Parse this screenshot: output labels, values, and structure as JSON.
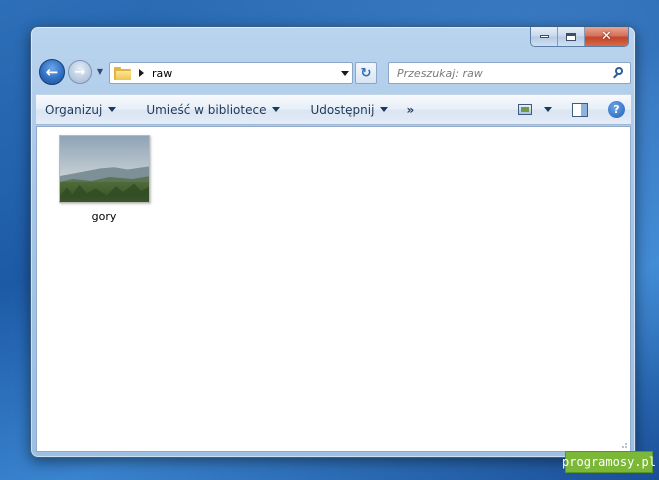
{
  "window": {
    "caption_buttons": {
      "minimize_icon": "minimize-icon",
      "maximize_icon": "maximize-icon",
      "close_label": "✕"
    }
  },
  "navigation": {
    "back_icon": "back-arrow-icon",
    "forward_icon": "forward-arrow-icon",
    "history_dropdown_icon": "chevron-down-icon",
    "address": {
      "folder_icon": "folder-icon",
      "crumbs": [
        "raw"
      ]
    },
    "refresh_icon": "refresh-icon",
    "search": {
      "placeholder": "Przeszukaj: raw",
      "value": ""
    }
  },
  "toolbar": {
    "organize_label": "Organizuj",
    "library_label": "Umieść w bibliotece",
    "share_label": "Udostępnij",
    "more_label": "»",
    "views_icon": "change-view-icon",
    "preview_pane_icon": "preview-pane-icon",
    "help_icon": "help-icon",
    "help_label": "?"
  },
  "files": [
    {
      "name": "gory",
      "type": "image",
      "thumbnail": "mountain-landscape"
    }
  ],
  "watermark": {
    "text": "programosy.pl",
    "color": "#7cb838"
  },
  "colors": {
    "desktop": "#1d5aa6",
    "frame": "#a7c6e6",
    "close_button": "#c4452a"
  }
}
